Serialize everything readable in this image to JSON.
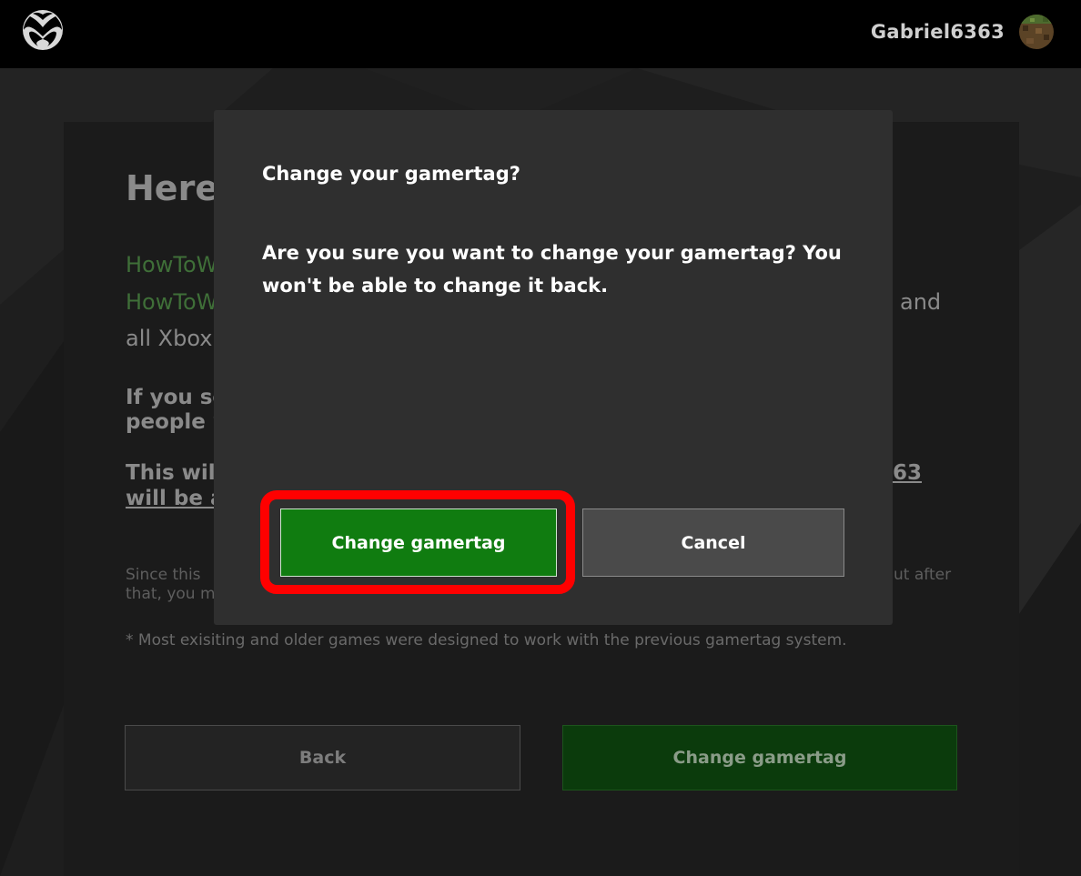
{
  "header": {
    "username": "Gabriel6363",
    "logo_icon": "xbox-logo-icon",
    "avatar_icon": "avatar-image"
  },
  "page": {
    "heading": "Here'",
    "lines": {
      "l1": "HowToW",
      "l2": "HowToW",
      "l2_end": "and",
      "l3": "all Xbox",
      "l4": "If you se",
      "l5": "people w",
      "l6": "This will",
      "l6_end": "63",
      "l7": "will be a",
      "small1": "Since this",
      "small1_end": "ut after",
      "small2": "that, you m",
      "footnote": "* Most exisiting and older games were designed to work with the previous gamertag system."
    },
    "back_label": "Back",
    "change_label": "Change gamertag"
  },
  "dialog": {
    "title": "Change your gamertag?",
    "body": "Are you sure you want to change your gamertag? You won't be able to change it back.",
    "confirm_label": "Change gamertag",
    "cancel_label": "Cancel"
  },
  "colors": {
    "accent_green": "#107c10",
    "highlight_red": "#ff0000",
    "dialog_bg": "#2f2f2f"
  }
}
